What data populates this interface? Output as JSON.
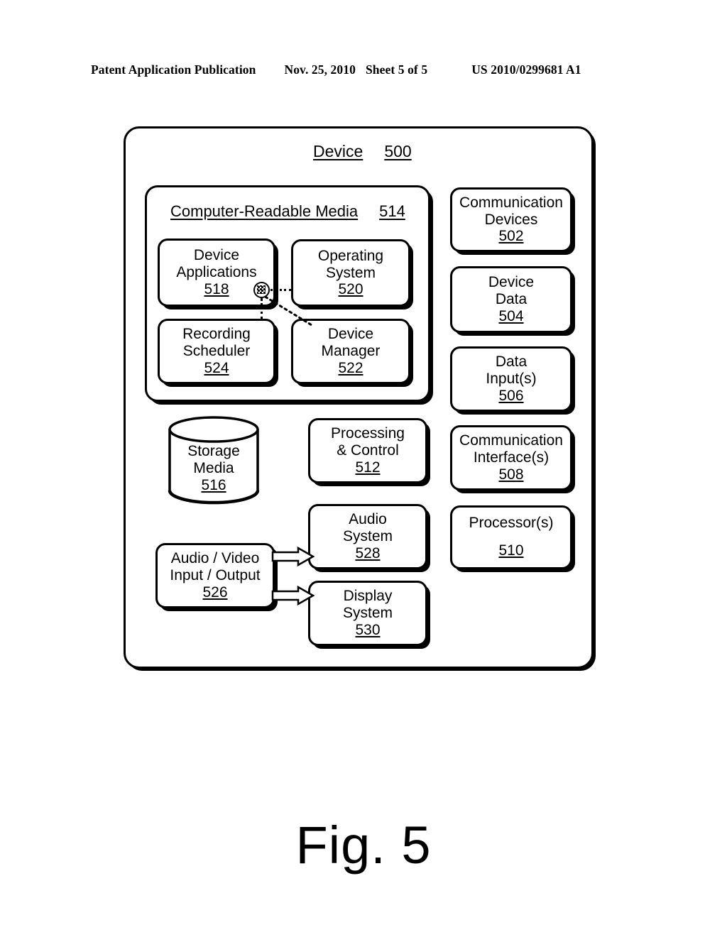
{
  "header": {
    "publication": "Patent Application Publication",
    "date": "Nov. 25, 2010",
    "sheet": "Sheet 5 of 5",
    "number": "US 2010/0299681 A1"
  },
  "figure": {
    "caption": "Fig. 5"
  },
  "diagram": {
    "device": {
      "title": "Device",
      "ref": "500"
    },
    "crm": {
      "title": "Computer-Readable Media",
      "ref": "514"
    },
    "boxes": {
      "device_applications": {
        "line1": "Device",
        "line2": "Applications",
        "ref": "518"
      },
      "operating_system": {
        "line1": "Operating",
        "line2": "System",
        "ref": "520"
      },
      "recording_scheduler": {
        "line1": "Recording",
        "line2": "Scheduler",
        "ref": "524"
      },
      "device_manager": {
        "line1": "Device",
        "line2": "Manager",
        "ref": "522"
      },
      "storage_media": {
        "line1": "Storage",
        "line2": "Media",
        "ref": "516"
      },
      "processing_control": {
        "line1": "Processing",
        "line2": "& Control",
        "ref": "512"
      },
      "av_input_output": {
        "line1": "Audio / Video",
        "line2": "Input / Output",
        "ref": "526"
      },
      "audio_system": {
        "line1": "Audio",
        "line2": "System",
        "ref": "528"
      },
      "display_system": {
        "line1": "Display",
        "line2": "System",
        "ref": "530"
      },
      "communication_devices": {
        "line1": "Communication",
        "line2": "Devices",
        "ref": "502"
      },
      "device_data": {
        "line1": "Device",
        "line2": "Data",
        "ref": "504"
      },
      "data_inputs": {
        "line1": "Data",
        "line2": "Input(s)",
        "ref": "506"
      },
      "communication_interfaces": {
        "line1": "Communication",
        "line2": "Interface(s)",
        "ref": "508"
      },
      "processors": {
        "line1": "Processor(s)",
        "line2": "",
        "ref": "510"
      }
    }
  },
  "colors": {
    "ink": "#000000",
    "paper": "#ffffff"
  }
}
